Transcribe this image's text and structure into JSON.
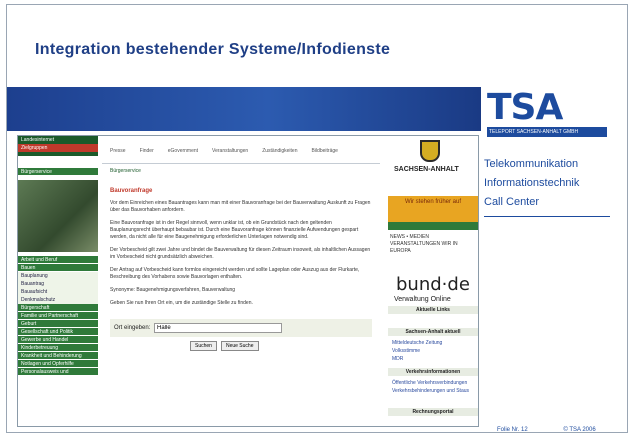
{
  "slide": {
    "title": "Integration bestehender Systeme/Infodienste",
    "logo_text": "TSA",
    "logo_sub": "TELEPORT SACHSEN-ANHALT GMBH",
    "services": [
      "Telekommunikation",
      "Informationstechnik",
      "Call Center"
    ],
    "footer_page": "Folie Nr. 12",
    "footer_copy": "© TSA 2006"
  },
  "website": {
    "left_nav_top": [
      "Landesinternet",
      "Zielgruppen"
    ],
    "left_nav_section": "Bürgerservice",
    "left_nav_items": [
      "Arbeit und Beruf",
      "Bauen",
      "Bauplanung",
      "Bauantrag",
      "Bauaufsicht",
      "Denkmalschutz",
      "Bürgerschaft",
      "Familie und Partnerschaft",
      "Geburt",
      "Gesellschaft und Politik",
      "Gewerbe und Handel",
      "Kinderbetreuung",
      "Krankheit und Behinderung",
      "Notlagen und Opferhilfe",
      "Personalausweis und"
    ],
    "menu": [
      "Presse",
      "Finder",
      "eGovernment",
      "Veranstaltungen",
      "Zuständigkeiten",
      "Bildbeiträge"
    ],
    "crumb": "Bürgerservice",
    "heading": "Bauvoranfrage",
    "paragraphs": [
      "Vor dem Einreichen eines Bauantrages kann man mit einer Bauvoranfrage bei der Bauverwaltung Auskunft zu Fragen über das Bauvorhaben anfordern.",
      "Eine Bauvoranfrage ist in der Regel sinnvoll, wenn unklar ist, ob ein Grundstück nach den geltenden Bauplanungsrecht überhaupt bebaubar ist. Durch eine Bauvoranfrage können finanzielle Aufwendungen gespart werden, da nicht alle für eine Baugenehmigung erforderlichen Unterlagen notwendig sind.",
      "Der Vorbescheid gilt zwei Jahre und bindet die Bauverwaltung für diesen Zeitraum insoweit, als inhaltlichen Aussagen im Vorbescheid nicht grundsätzlich abweichen.",
      "Der Antrag auf Vorbescheid kann formlos eingereicht werden und sollte Lageplan oder Auszug aus der Flurkarte, Beschreibung des Vorhabens sowie Bauvorlagen enthalten.",
      "Synonyme: Baugenehmigungsverfahren, Bauverwaltung",
      "Geben Sie nun Ihren Ort ein, um die zuständige Stelle zu finden."
    ],
    "search_label": "Ort eingeben:",
    "search_value": "Halle",
    "btn_search": "Suchen",
    "btn_new": "Neue Suche",
    "state_name": "SACHSEN-ANHALT",
    "promo": "Wir stehen früher auf",
    "news": "NEWS • MEDIEN  VERANSTALTUNGEN  WIR IN EUROPA",
    "bund_logo": "bund·de",
    "bund_sub": "Verwaltung Online",
    "right_sections": [
      "Aktuelle Links",
      "Sachsen-Anhalt aktuell",
      "Verkehrsinformationen",
      "Rechnungsportal"
    ],
    "right_links": [
      "Mitteldeutsche Zeitung",
      "Volksstimme",
      "MDR",
      "Öffentliche Verkehrsverbindungen",
      "Verkehrsbehinderungen und Staus"
    ]
  },
  "colors": {
    "title": "#1f3f86",
    "band": "#2c5bb0",
    "site_green": "#1b5a2a",
    "site_red": "#c0392b"
  }
}
